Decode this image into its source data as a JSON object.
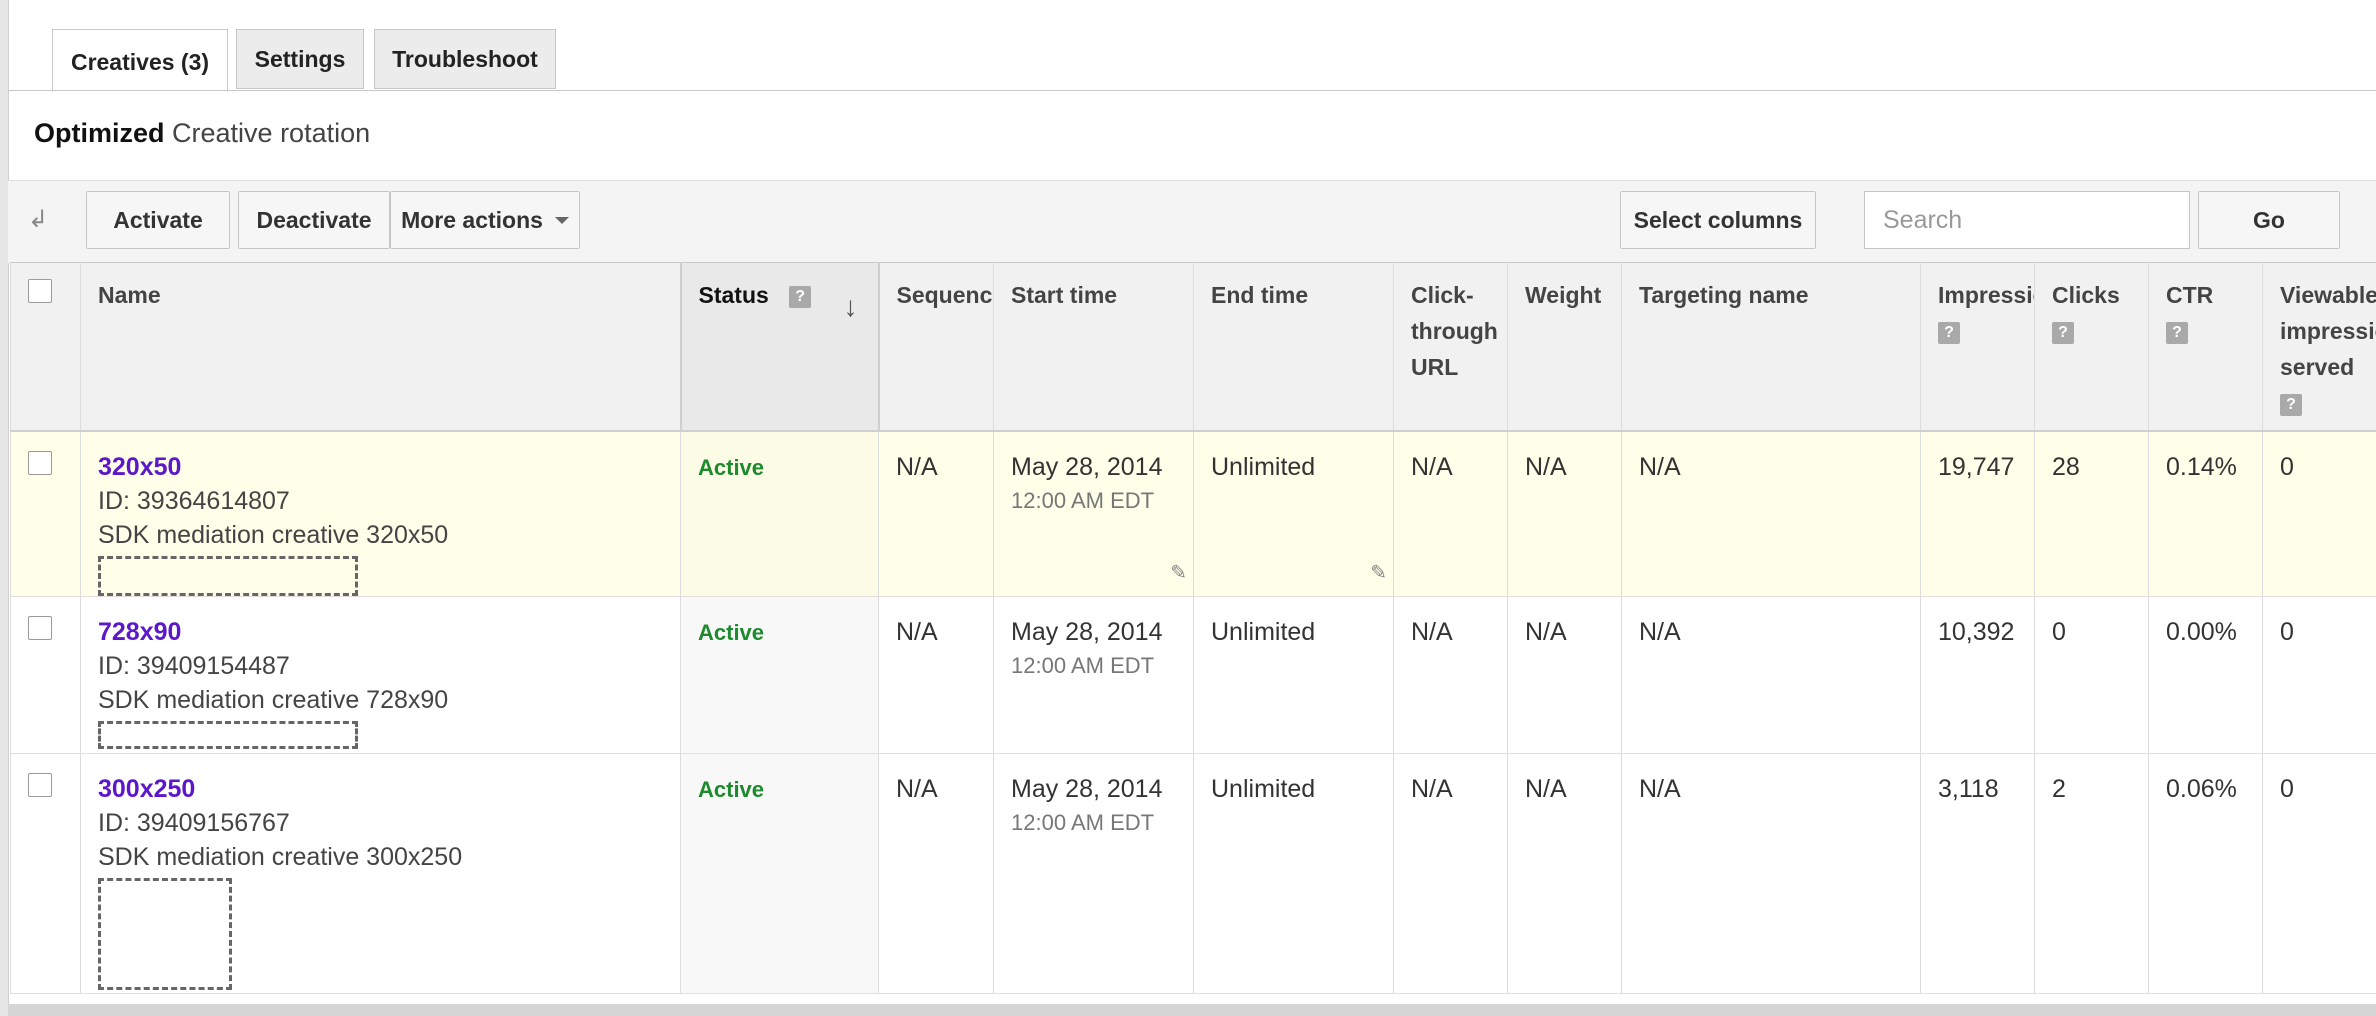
{
  "tabs": [
    {
      "label": "Creatives (3)",
      "active": true
    },
    {
      "label": "Settings",
      "active": false
    },
    {
      "label": "Troubleshoot",
      "active": false
    }
  ],
  "rotation": {
    "strong": "Optimized",
    "text": "Creative rotation"
  },
  "toolbar": {
    "activate": "Activate",
    "deactivate": "Deactivate",
    "more_actions": "More actions",
    "select_columns": "Select columns",
    "search_placeholder": "Search",
    "go": "Go"
  },
  "columns": {
    "name": "Name",
    "status": "Status",
    "sequence": "Sequence",
    "start_time": "Start time",
    "end_time": "End time",
    "click_through": [
      "Click-",
      "through",
      "URL"
    ],
    "weight": "Weight",
    "targeting": "Targeting name",
    "impressions": "Impressions",
    "clicks": "Clicks",
    "ctr": "CTR",
    "viewable": [
      "Viewable",
      "impressions",
      "served"
    ]
  },
  "rows": [
    {
      "name": "320x50",
      "id": "ID: 39364614807",
      "desc": "SDK mediation creative 320x50",
      "status": "Active",
      "sequence": "N/A",
      "start_date": "May 28, 2014",
      "start_time": "12:00 AM EDT",
      "end": "Unlimited",
      "url": "N/A",
      "weight": "N/A",
      "targeting": "N/A",
      "impressions": "19,747",
      "clicks": "28",
      "ctr": "0.14%",
      "viewable": "0"
    },
    {
      "name": "728x90",
      "id": "ID: 39409154487",
      "desc": "SDK mediation creative 728x90",
      "status": "Active",
      "sequence": "N/A",
      "start_date": "May 28, 2014",
      "start_time": "12:00 AM EDT",
      "end": "Unlimited",
      "url": "N/A",
      "weight": "N/A",
      "targeting": "N/A",
      "impressions": "10,392",
      "clicks": "0",
      "ctr": "0.00%",
      "viewable": "0"
    },
    {
      "name": "300x250",
      "id": "ID: 39409156767",
      "desc": "SDK mediation creative 300x250",
      "status": "Active",
      "sequence": "N/A",
      "start_date": "May 28, 2014",
      "start_time": "12:00 AM EDT",
      "end": "Unlimited",
      "url": "N/A",
      "weight": "N/A",
      "targeting": "N/A",
      "impressions": "3,118",
      "clicks": "2",
      "ctr": "0.06%",
      "viewable": "0"
    }
  ],
  "icons": {
    "help": "?",
    "sort": "↓",
    "undo": "↲",
    "pencil": "✎"
  },
  "colors": {
    "link": "#5b17c9",
    "active_status": "#1e8a2e",
    "highlight_row": "#fefee9"
  }
}
